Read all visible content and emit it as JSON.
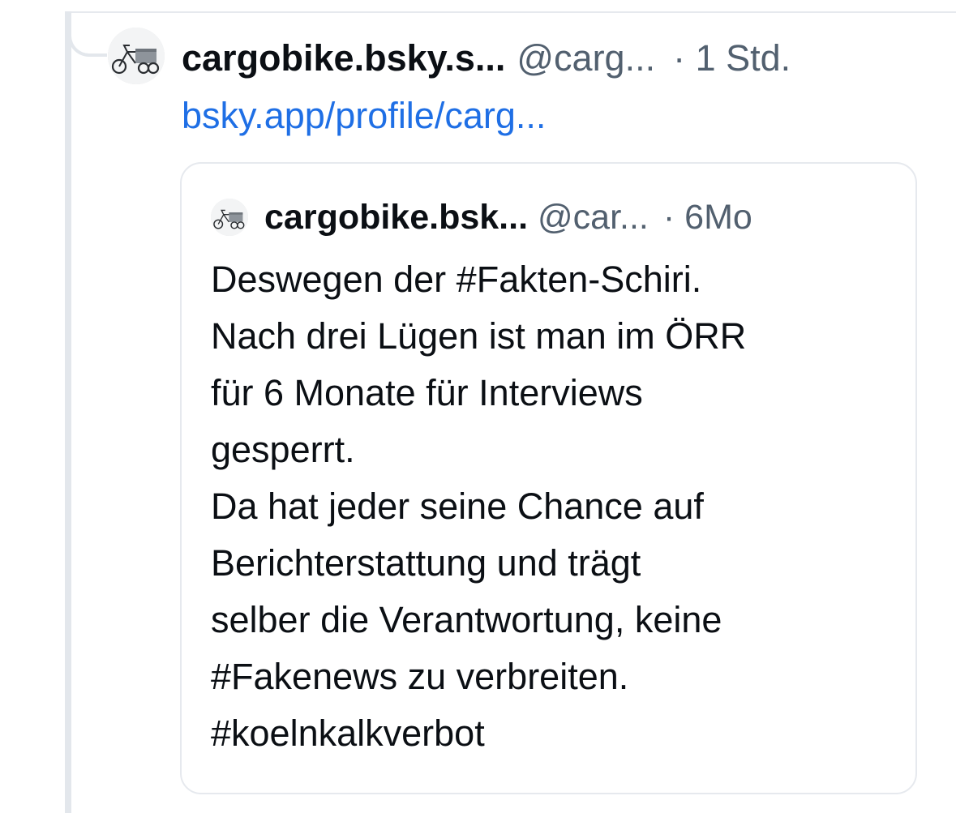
{
  "post": {
    "display_name": "cargobike.bsky.s...",
    "handle": "@carg...",
    "timestamp": "· 1 Std.",
    "link_text": "bsky.app/profile/carg...",
    "avatar_icon": "cargo-bike-icon"
  },
  "quote": {
    "display_name": "cargobike.bsk...",
    "handle": "@car...",
    "timestamp": "· 6Mo",
    "avatar_icon": "cargo-bike-icon",
    "lines": [
      "Deswegen der #Fakten-Schiri.",
      "Nach drei Lügen ist man im ÖRR",
      "für 6 Monate für Interviews",
      "gesperrt.",
      "Da hat jeder seine Chance auf",
      "Berichterstattung und trägt",
      "selber die Verantwortung, keine",
      "#Fakenews zu verbreiten.",
      "#koelnkalkverbot"
    ]
  },
  "colors": {
    "link": "#1f6fe5",
    "text": "#0b0f14",
    "muted": "#52606f",
    "border": "#e6e9ee"
  }
}
